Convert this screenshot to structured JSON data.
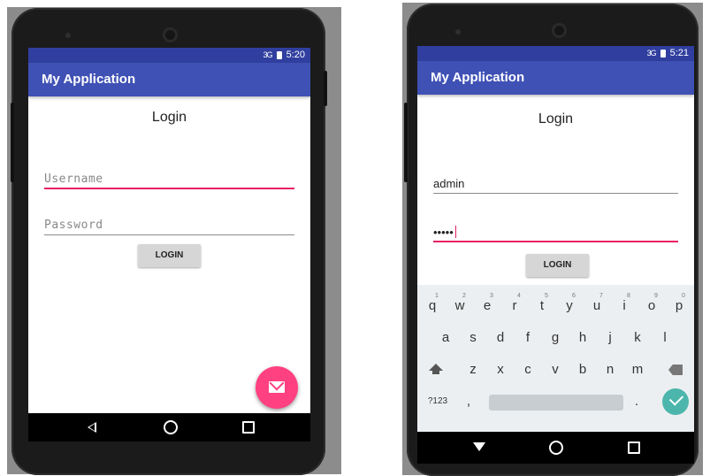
{
  "left_phone": {
    "status_time": "5:20",
    "signal": "3G",
    "app_title": "My Application",
    "login_title": "Login",
    "username_placeholder": "Username",
    "password_placeholder": "Password",
    "login_button": "LOGIN"
  },
  "right_phone": {
    "status_time": "5:21",
    "signal": "3G",
    "app_title": "My Application",
    "login_title": "Login",
    "username_value": "admin",
    "password_value": "•••••",
    "login_button": "LOGIN",
    "keyboard": {
      "row1": [
        {
          "key": "q",
          "num": "1"
        },
        {
          "key": "w",
          "num": "2"
        },
        {
          "key": "e",
          "num": "3"
        },
        {
          "key": "r",
          "num": "4"
        },
        {
          "key": "t",
          "num": "5"
        },
        {
          "key": "y",
          "num": "6"
        },
        {
          "key": "u",
          "num": "7"
        },
        {
          "key": "i",
          "num": "8"
        },
        {
          "key": "o",
          "num": "9"
        },
        {
          "key": "p",
          "num": "0"
        }
      ],
      "row2": [
        "a",
        "s",
        "d",
        "f",
        "g",
        "h",
        "j",
        "k",
        "l"
      ],
      "row3": [
        "z",
        "x",
        "c",
        "v",
        "b",
        "n",
        "m"
      ],
      "symbols_key": "?123",
      "comma_key": ",",
      "period_key": "."
    }
  },
  "colors": {
    "status_bar": "#303f9f",
    "app_bar": "#3f51b5",
    "accent": "#ff4081",
    "focus_underline": "#e91e63",
    "enter_key": "#4db6ac"
  },
  "icons": [
    "signal-icon",
    "battery-icon",
    "mail-icon",
    "back-icon",
    "home-icon",
    "recents-icon",
    "shift-icon",
    "backspace-icon",
    "check-icon"
  ]
}
